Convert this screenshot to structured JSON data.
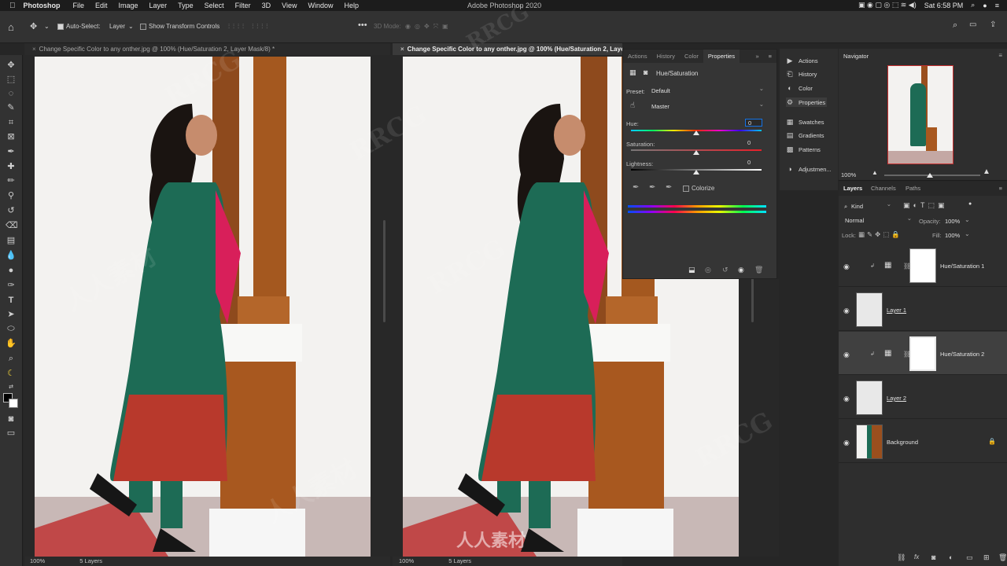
{
  "menubar": {
    "app": "Photoshop",
    "items": [
      "File",
      "Edit",
      "Image",
      "Layer",
      "Type",
      "Select",
      "Filter",
      "3D",
      "View",
      "Window",
      "Help"
    ],
    "window_title": "Adobe Photoshop 2020",
    "clock": "Sat 6:58 PM"
  },
  "options": {
    "auto_select_label": "Auto-Select:",
    "auto_select_value": "Layer",
    "transform_label": "Show Transform Controls",
    "mode_3d": "3D Mode:"
  },
  "tabs": {
    "doc1": "Change Specific Color to any onther.jpg @ 100% (Hue/Saturation 2, Layer Mask/8) *",
    "doc2": "Change Specific Color to any onther.jpg @ 100% (Hue/Saturation 2, Layer"
  },
  "status": {
    "zoom1": "100%",
    "layers1": "5 Layers",
    "zoom2": "100%",
    "layers2": "5 Layers"
  },
  "properties": {
    "tabs": [
      "Actions",
      "History",
      "Color",
      "Properties"
    ],
    "title": "Hue/Saturation",
    "preset_label": "Preset:",
    "preset_value": "Default",
    "channel_value": "Master",
    "hue_label": "Hue:",
    "hue_value": "0",
    "hue_level": 0.5,
    "saturation_label": "Saturation:",
    "saturation_value": "0",
    "saturation_level": 0.5,
    "lightness_label": "Lightness:",
    "lightness_value": "0",
    "lightness_level": 0.5,
    "colorize_label": "Colorize"
  },
  "dock": {
    "items": [
      "Actions",
      "History",
      "Color",
      "Properties",
      "Swatches",
      "Gradients",
      "Patterns",
      "Adjustmen..."
    ]
  },
  "navigator": {
    "title": "Navigator",
    "zoom": "100%"
  },
  "layers_panel": {
    "tabs": [
      "Layers",
      "Channels",
      "Paths"
    ],
    "filter": "Kind",
    "blend": "Normal",
    "opacity_label": "Opacity:",
    "opacity": "100%",
    "lock_label": "Lock:",
    "fill_label": "Fill:",
    "fill": "100%",
    "layers": [
      {
        "name": "Hue/Saturation 1"
      },
      {
        "name": "Layer 1"
      },
      {
        "name": "Hue/Saturation 2"
      },
      {
        "name": "Layer 2"
      },
      {
        "name": "Background"
      }
    ]
  },
  "watermark": {
    "text1": "RRCG",
    "text2": "人人素材"
  },
  "colors": {
    "panel": "#323232",
    "accent": "#1473e6",
    "dress_green": "#1d6b55",
    "pillar": "#9a4f1e"
  }
}
